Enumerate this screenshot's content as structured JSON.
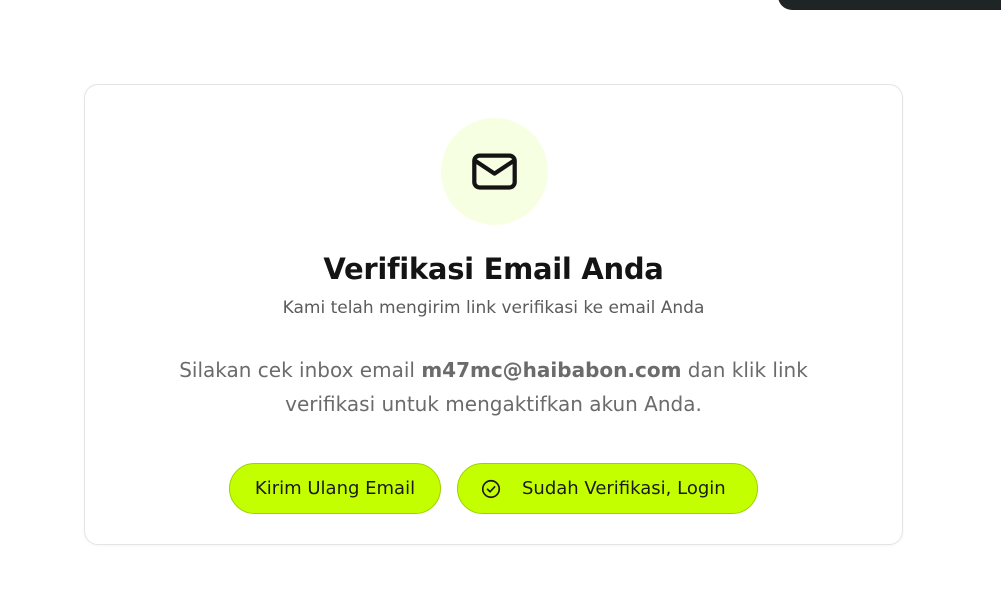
{
  "verification": {
    "title": "Verifikasi Email Anda",
    "subtitle": "Kami telah mengirim link verifikasi ke email Anda",
    "instruction_before": "Silakan cek inbox email ",
    "email": "m47mc@haibabon.com",
    "instruction_after": " dan klik link verifikasi untuk mengaktifkan akun Anda.",
    "icon": "mail-icon"
  },
  "actions": {
    "resend_label": "Kirim Ulang Email",
    "login_label": "Sudah Verifikasi, Login",
    "login_icon": "check-circle-icon"
  },
  "colors": {
    "accent": "#c4ff00",
    "accent_border": "#9bd300",
    "icon_bg": "#f7ffe3",
    "text_dark": "#141414",
    "text_muted": "#6b6b6b"
  }
}
